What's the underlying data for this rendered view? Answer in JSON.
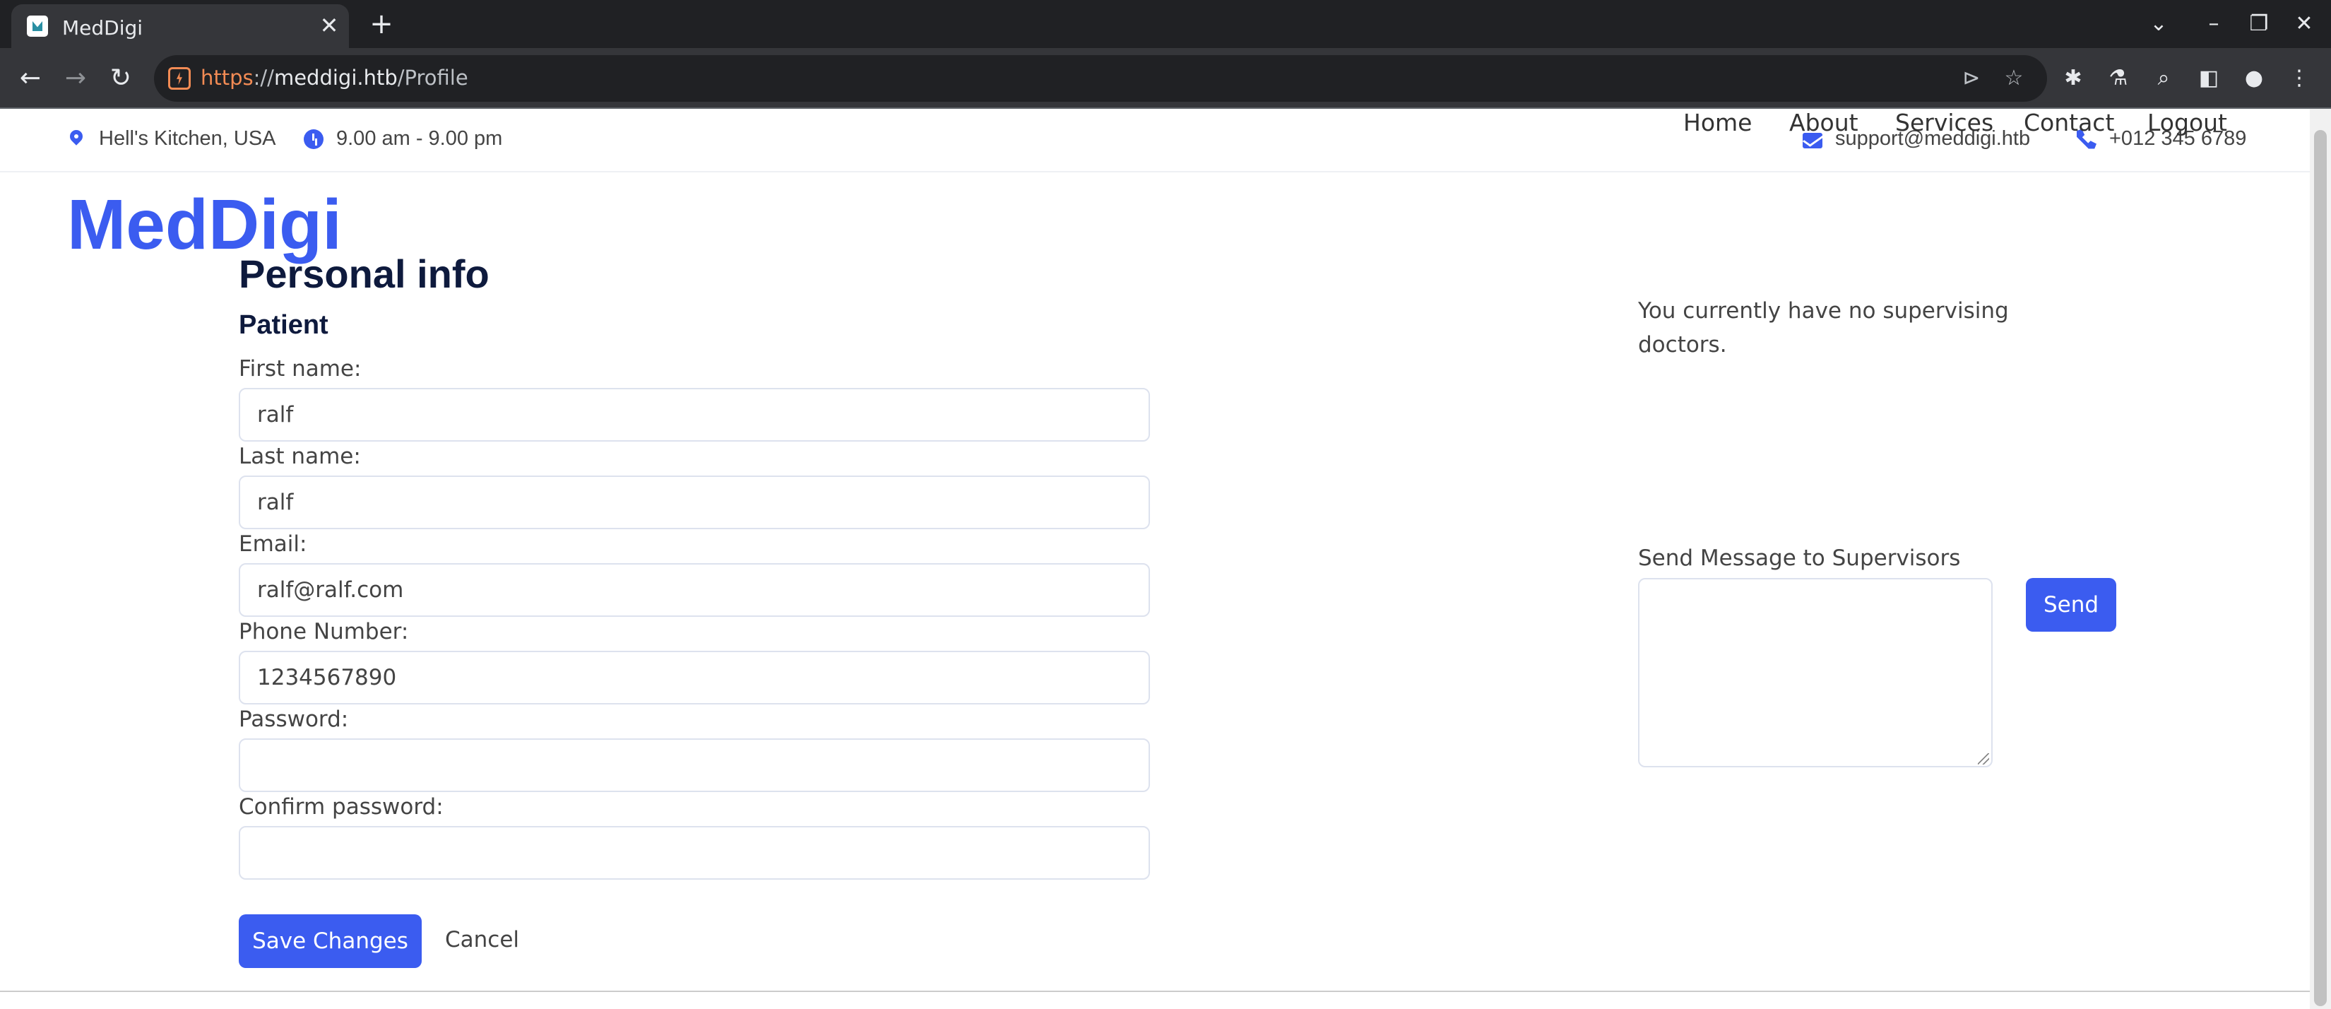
{
  "browser": {
    "tab_title": "MedDigi",
    "url_scheme": "https",
    "url_sep": "://",
    "url_host": "meddigi.htb",
    "url_path": "/Profile"
  },
  "topbar": {
    "location": "Hell's Kitchen, USA",
    "hours": "9.00 am - 9.00 pm",
    "email": "support@meddigi.htb",
    "phone": "+012 345 6789"
  },
  "header": {
    "logo": "MedDigi",
    "nav": [
      "Home",
      "About",
      "Services",
      "Contact",
      "Logout"
    ]
  },
  "profile": {
    "title": "Personal info",
    "role": "Patient",
    "fields": [
      {
        "label": "First name:",
        "value": "ralf"
      },
      {
        "label": "Last name:",
        "value": "ralf"
      },
      {
        "label": "Email:",
        "value": "ralf@ralf.com"
      },
      {
        "label": "Phone Number:",
        "value": "1234567890"
      },
      {
        "label": "Password:",
        "value": ""
      },
      {
        "label": "Confirm password:",
        "value": ""
      }
    ],
    "save_label": "Save Changes",
    "cancel_label": "Cancel"
  },
  "supervisors": {
    "empty_text": "You currently have no supervising doctors.",
    "message_label": "Send Message to Supervisors",
    "message_value": "",
    "send_label": "Send"
  },
  "icons": {
    "location": "map-pin-icon",
    "hours": "clock-icon",
    "email": "envelope-icon",
    "phone": "phone-icon"
  },
  "colors": {
    "accent": "#3b5cf0",
    "heading": "#0e1a3d"
  }
}
